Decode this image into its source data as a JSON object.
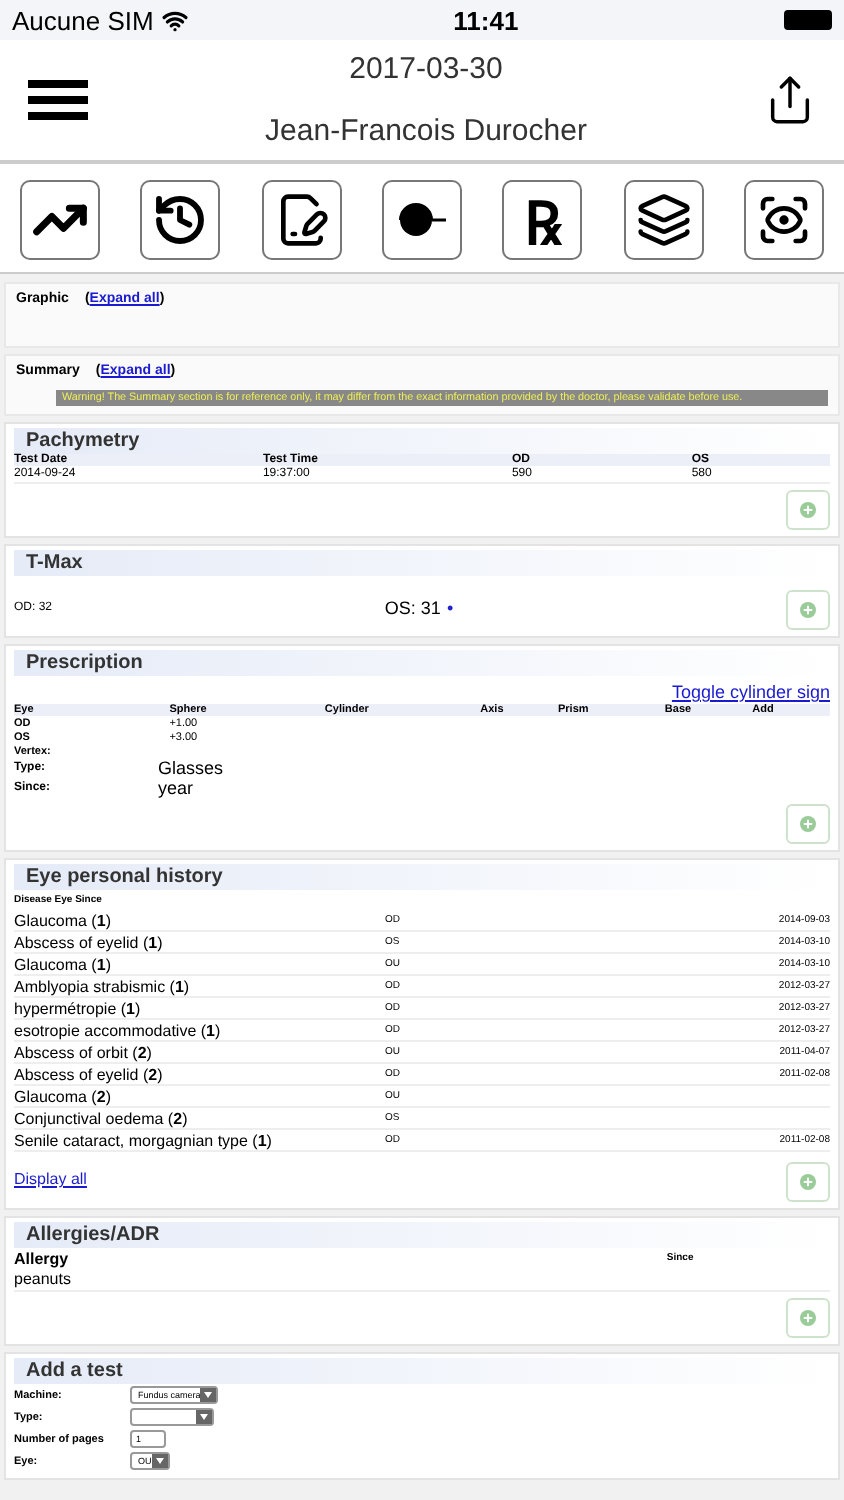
{
  "status_bar": {
    "carrier": "Aucune SIM",
    "time": "11:41"
  },
  "header": {
    "date": "2017-03-30",
    "patient": "Jean-Francois Durocher"
  },
  "toolbar": [
    {
      "kind": "chart"
    },
    {
      "kind": "history"
    },
    {
      "kind": "notes"
    },
    {
      "kind": "eyeball"
    },
    {
      "kind": "glyph",
      "text": "℞"
    },
    {
      "kind": "layers"
    },
    {
      "kind": "eye-target"
    }
  ],
  "graphic": {
    "title": "Graphic",
    "open": "(",
    "link": "Expand all",
    "close": ")"
  },
  "summary": {
    "title": "Summary",
    "open": "(",
    "link": "Expand all",
    "close": ")",
    "warning": "Warning! The Summary section is for reference only, it may differ from the exact information provided by the doctor, please validate before use."
  },
  "pachymetry": {
    "title": "Pachymetry",
    "columns": [
      "Test Date",
      "Test Time",
      "OD",
      "OS"
    ],
    "rows": [
      [
        "2014-09-24",
        "19:37:00",
        "590",
        "580"
      ]
    ]
  },
  "tmax": {
    "title": "T-Max",
    "od": "OD: 32",
    "os": "OS: 31",
    "marker": "•"
  },
  "prescription": {
    "title": "Prescription",
    "toggle": "Toggle cylinder sign",
    "columns": [
      "Eye",
      "Sphere",
      "Cylinder",
      "Axis",
      "Prism",
      "Base",
      "Add"
    ],
    "rows": [
      [
        "OD",
        "+1.00"
      ],
      [
        "OS",
        "+3.00"
      ],
      [
        "Vertex:"
      ]
    ],
    "fields": [
      {
        "label": "Type:",
        "value": "Glasses"
      },
      {
        "label": "Since:",
        "value": "year"
      }
    ]
  },
  "history": {
    "title": "Eye personal history",
    "header": "Disease Eye Since",
    "display_all": "Display all",
    "rows": [
      {
        "disease": "Glaucoma (**1**)",
        "eye": "OD",
        "since": "2014-09-03"
      },
      {
        "disease": "Abscess of eyelid (**1**)",
        "eye": "OS",
        "since": "2014-03-10"
      },
      {
        "disease": "Glaucoma (**1**)",
        "eye": "OU",
        "since": "2014-03-10"
      },
      {
        "disease": "Amblyopia strabismic (**1**)",
        "eye": "OD",
        "since": "2012-03-27"
      },
      {
        "disease": "hypermétropie (**1**)",
        "eye": "OD",
        "since": "2012-03-27"
      },
      {
        "disease": "esotropie accommodative (**1**)",
        "eye": "OD",
        "since": "2012-03-27"
      },
      {
        "disease": "Abscess of orbit (**2**)",
        "eye": "OU",
        "since": "2011-04-07"
      },
      {
        "disease": "Abscess of eyelid (**2**)",
        "eye": "OD",
        "since": "2011-02-08"
      },
      {
        "disease": "Glaucoma (**2**)",
        "eye": "OU"
      },
      {
        "disease": "Conjunctival oedema (**2**)",
        "eye": "OS"
      },
      {
        "disease": "Senile cataract, morgagnian type (**1**)",
        "eye": "OD",
        "since": "2011-02-08"
      }
    ]
  },
  "allergies": {
    "title": "Allergies/ADR",
    "columns": [
      "Allergy",
      "Since"
    ],
    "rows": [
      "peanuts"
    ]
  },
  "add_test": {
    "title": "Add a test",
    "fields": [
      {
        "label": "Machine:",
        "kind": "select",
        "value": "Fundus camera"
      },
      {
        "label": "Type:",
        "kind": "select"
      },
      {
        "label": "Number of pages",
        "kind": "input",
        "value": "1"
      },
      {
        "label": "Eye:",
        "kind": "select",
        "value": "OU"
      }
    ]
  }
}
